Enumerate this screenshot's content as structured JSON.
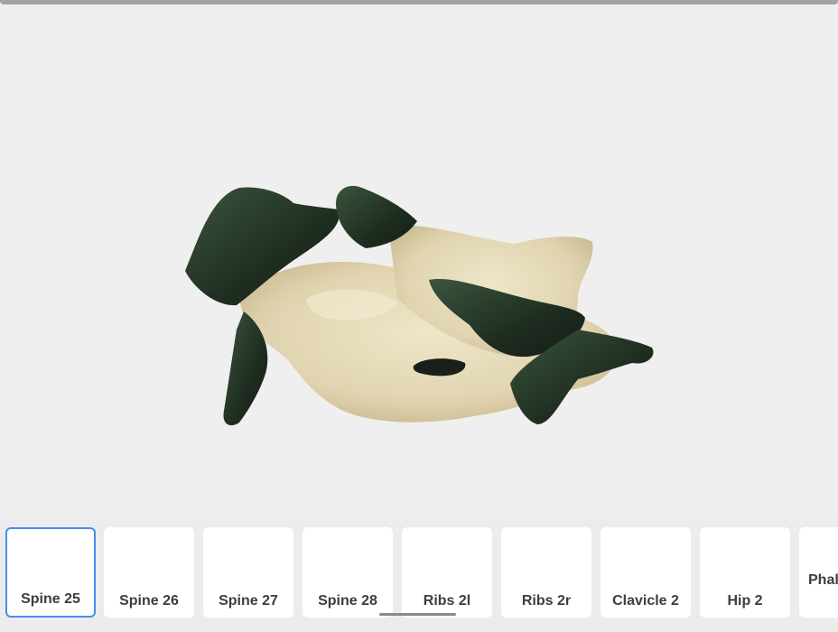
{
  "viewer": {
    "model_icon": "vertebra-3d-model",
    "bone_colors": {
      "bone": "#e6dcbc",
      "bone_shadow": "#c7b88f",
      "dark_patch": "#1e2b1f",
      "dark_patch_light": "#35503a"
    }
  },
  "carousel": {
    "selected_index": 0,
    "items": [
      {
        "label": "Spine 25"
      },
      {
        "label": "Spine 26"
      },
      {
        "label": "Spine 27"
      },
      {
        "label": "Spine 28"
      },
      {
        "label": "Ribs 2l"
      },
      {
        "label": "Ribs 2r"
      },
      {
        "label": "Clavicle 2"
      },
      {
        "label": "Hip 2"
      },
      {
        "label": "Phal"
      }
    ],
    "selection_color": "#4a8bf0"
  }
}
